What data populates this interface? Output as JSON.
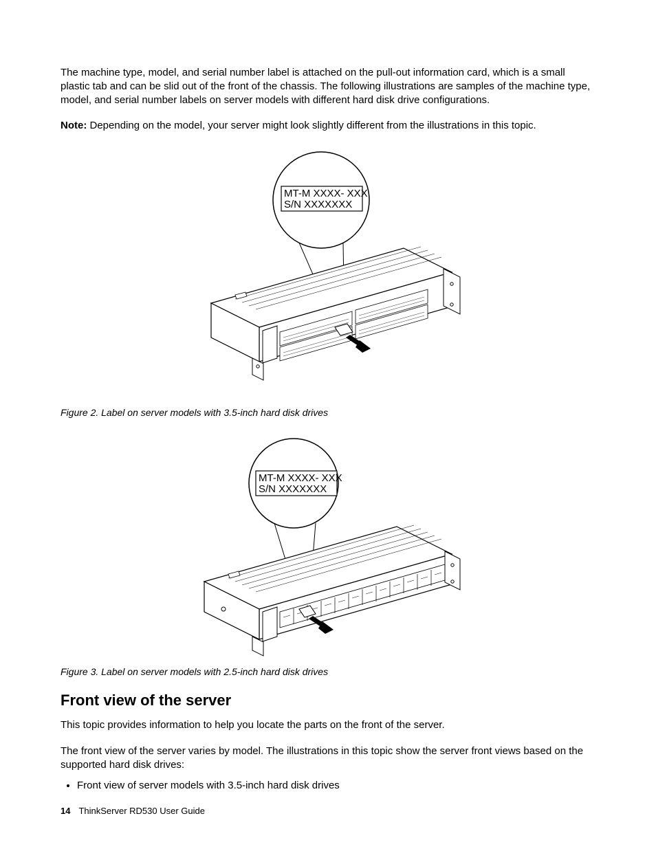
{
  "para1": "The machine type, model, and serial number label is attached on the pull-out information card, which is a small plastic tab and can be slid out of the front of the chassis. The following illustrations are samples of the machine type, model, and serial number labels on server models with different hard disk drive configurations.",
  "note": {
    "label": "Note:",
    "text": " Depending on the model, your server might look slightly different from the illustrations in this topic."
  },
  "fig2": {
    "label_line1": "MT-M XXXX- XXX",
    "label_line2": "S/N XXXXXXX",
    "caption": "Figure 2.  Label on server models with 3.5-inch hard disk drives"
  },
  "fig3": {
    "label_line1": "MT-M XXXX- XXX",
    "label_line2": "S/N XXXXXXX",
    "caption": "Figure 3.  Label on server models with 2.5-inch hard disk drives"
  },
  "section_heading": "Front view of the server",
  "para2": "This topic provides information to help you locate the parts on the front of the server.",
  "para3": "The front view of the server varies by model. The illustrations in this topic show the server front views based on the supported hard disk drives:",
  "bullets": [
    "Front view of server models with 3.5-inch hard disk drives"
  ],
  "footer": {
    "page": "14",
    "title": "ThinkServer RD530 User Guide"
  }
}
